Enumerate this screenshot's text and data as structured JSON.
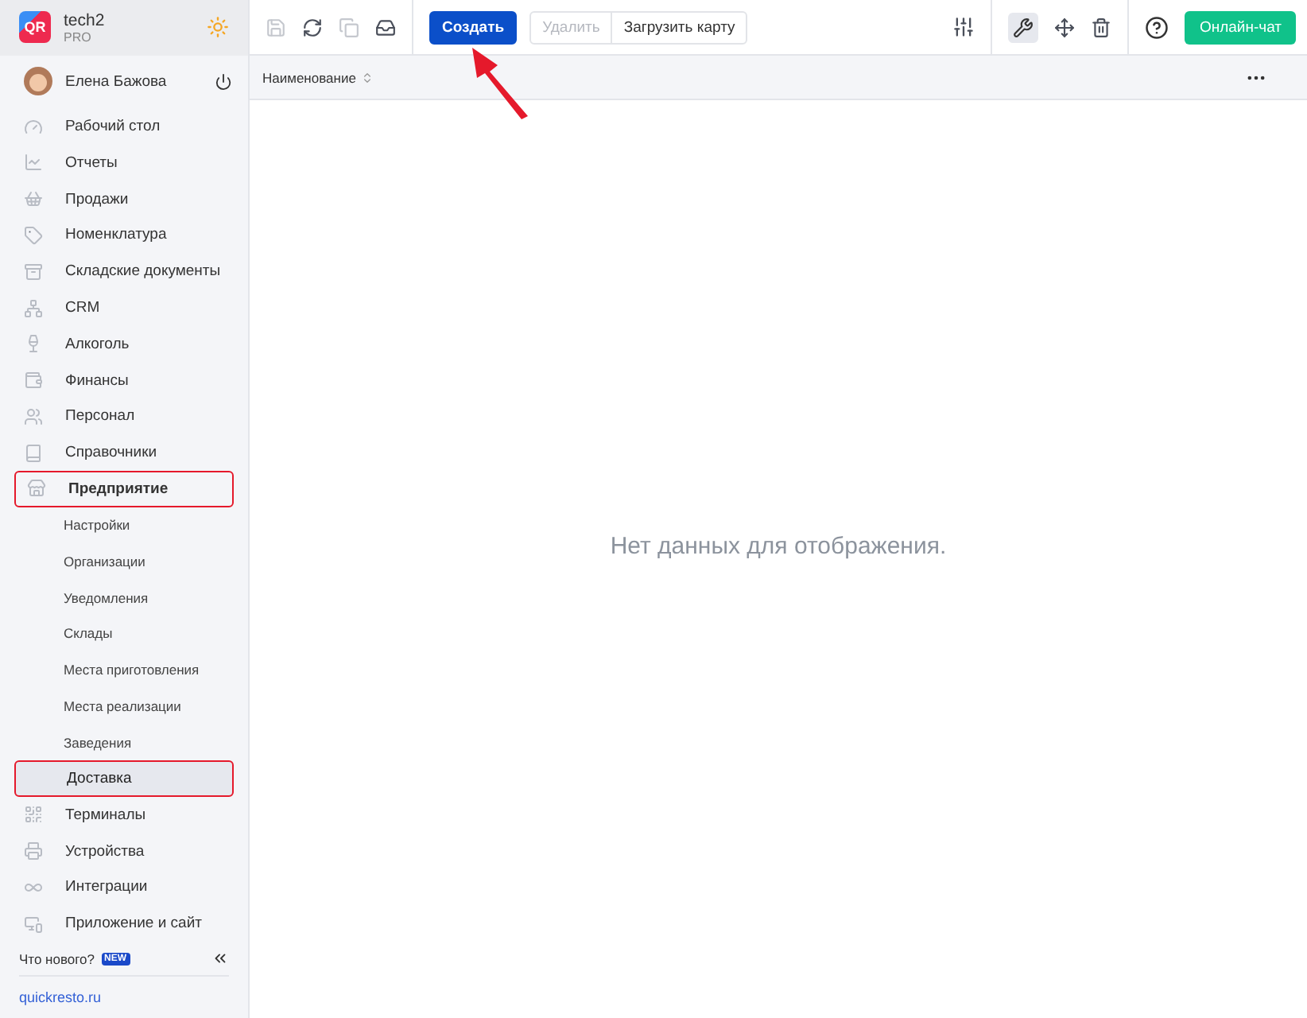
{
  "brand": {
    "logo": "QR",
    "name": "tech2",
    "plan": "PRO"
  },
  "user": {
    "name": "Елена Бажова"
  },
  "menu": [
    {
      "label": "Рабочий стол",
      "highlighted": false,
      "expanded": false
    },
    {
      "label": "Отчеты",
      "highlighted": false,
      "expanded": false
    },
    {
      "label": "Продажи",
      "highlighted": false,
      "expanded": false
    },
    {
      "label": "Номенклатура",
      "highlighted": false,
      "expanded": false
    },
    {
      "label": "Складские документы",
      "highlighted": false,
      "expanded": false
    },
    {
      "label": "CRM",
      "highlighted": false,
      "expanded": false
    },
    {
      "label": "Алкоголь",
      "highlighted": false,
      "expanded": false
    },
    {
      "label": "Финансы",
      "highlighted": false,
      "expanded": false
    },
    {
      "label": "Персонал",
      "highlighted": false,
      "expanded": false
    },
    {
      "label": "Справочники",
      "highlighted": false,
      "expanded": false
    },
    {
      "label": "Предприятие",
      "highlighted": true,
      "expanded": true,
      "children": [
        {
          "label": "Настройки",
          "selected": false,
          "highlighted": false
        },
        {
          "label": "Организации",
          "selected": false,
          "highlighted": false
        },
        {
          "label": "Уведомления",
          "selected": false,
          "highlighted": false
        },
        {
          "label": "Склады",
          "selected": false,
          "highlighted": false
        },
        {
          "label": "Места приготовления",
          "selected": false,
          "highlighted": false
        },
        {
          "label": "Места реализации",
          "selected": false,
          "highlighted": false
        },
        {
          "label": "Заведения",
          "selected": false,
          "highlighted": false
        },
        {
          "label": "Доставка",
          "selected": true,
          "highlighted": true
        }
      ]
    },
    {
      "label": "Терминалы",
      "highlighted": false,
      "expanded": false
    },
    {
      "label": "Устройства",
      "highlighted": false,
      "expanded": false
    },
    {
      "label": "Интеграции",
      "highlighted": false,
      "expanded": false
    },
    {
      "label": "Приложение и сайт",
      "highlighted": false,
      "expanded": false
    }
  ],
  "whats_new": {
    "label": "Что нового?",
    "badge": "NEW"
  },
  "site_link": "quickresto.ru",
  "toolbar": {
    "icons": [
      {
        "disabled": true
      },
      {
        "disabled": false
      },
      {
        "disabled": true
      },
      {
        "disabled": false
      }
    ],
    "buttons": [
      {
        "label": "Создать",
        "kind": "primary",
        "disabled": false
      },
      {
        "label": "Удалить",
        "kind": "plain",
        "disabled": true
      },
      {
        "label": "Загрузить карту",
        "kind": "plain",
        "disabled": false
      }
    ],
    "chat": "Онлайн-чат"
  },
  "table": {
    "columns": [
      "Наименование"
    ],
    "empty_message": "Нет данных для отображения."
  }
}
